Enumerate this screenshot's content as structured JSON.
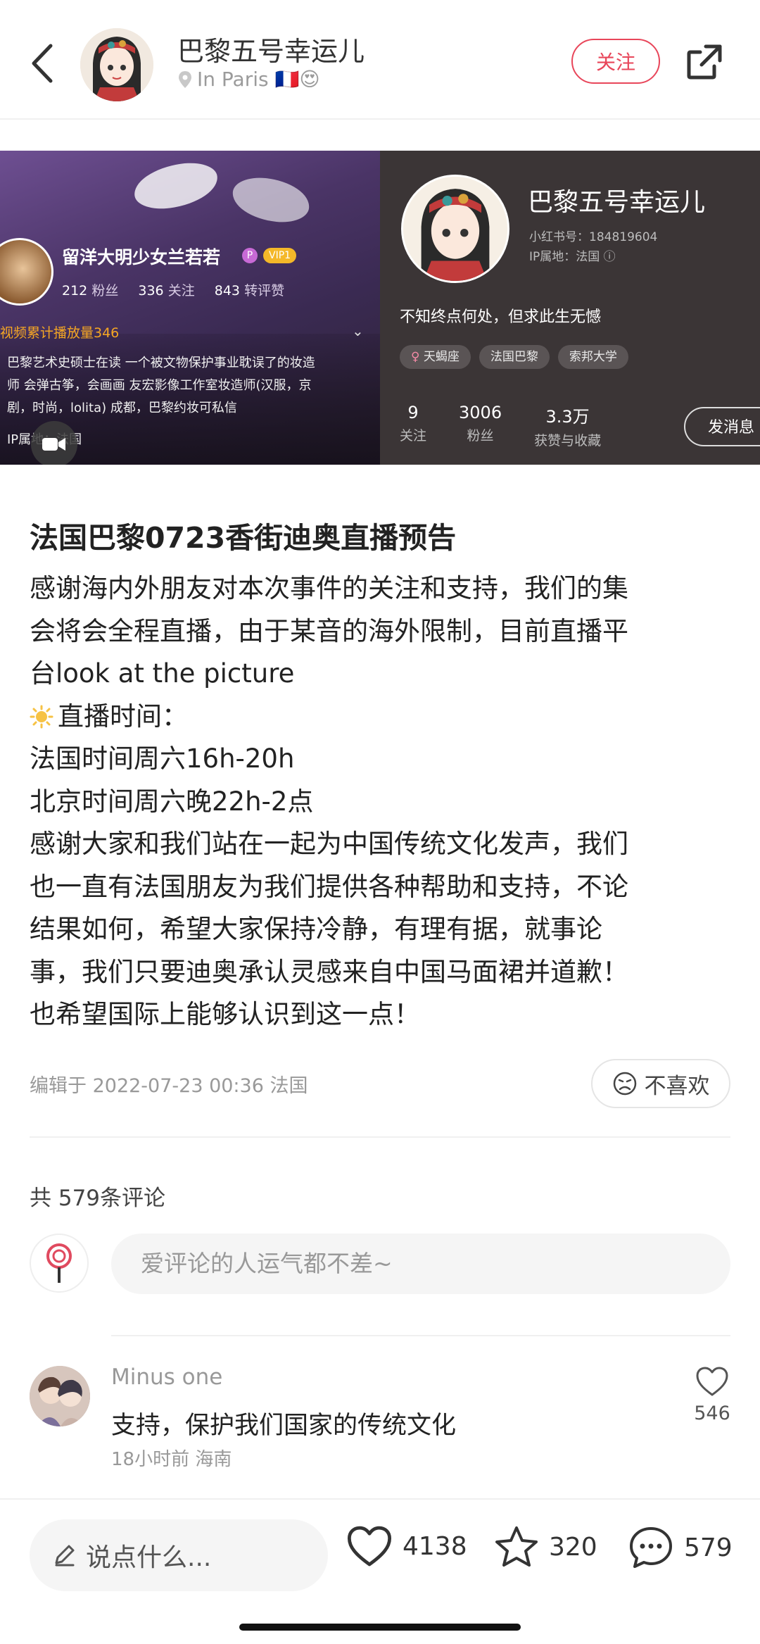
{
  "header": {
    "author_name": "巴黎五号幸运儿",
    "location": "In Paris 🇫🇷😍",
    "follow_label": "关注"
  },
  "banner_left": {
    "name": "留洋大明少女兰若若",
    "p_badge": "P",
    "vip_badge": "VIP1",
    "stats": [
      {
        "num": "212",
        "label": "粉丝"
      },
      {
        "num": "336",
        "label": "关注"
      },
      {
        "num": "843",
        "label": "转评赞"
      }
    ],
    "play_text": "视频累计播放量346",
    "bio_lines": [
      "巴黎艺术史硕士在读 一个被文物保护事业耽误了的妆造",
      "师 会弹古筝，会画画 友宏影像工作室妆造师(汉服，京",
      "剧，时尚，lolita) 成都，巴黎约妆可私信"
    ],
    "ip_text": "IP属地：法国"
  },
  "banner_right": {
    "name": "巴黎五号幸运儿",
    "id_text": "小红书号：184819604",
    "ip_text": "IP属地：法国",
    "bio": "不知终点何处，但求此生无憾",
    "tags": [
      "天蝎座",
      "法国巴黎",
      "索邦大学"
    ],
    "stats": [
      {
        "num": "9",
        "label": "关注"
      },
      {
        "num": "3006",
        "label": "粉丝"
      },
      {
        "num": "3.3万",
        "label": "获赞与收藏"
      }
    ],
    "message_label": "发消息"
  },
  "post": {
    "title": "法国巴黎0723香街迪奥直播预告",
    "lines": [
      "感谢海内外朋友对本次事件的关注和支持，我们的集",
      "会将会全程直播，由于某音的海外限制，目前直播平",
      "台look at the picture",
      "直播时间：",
      "法国时间周六16h-20h",
      "北京时间周六晚22h-2点",
      "感谢大家和我们站在一起为中国传统文化发声，我们",
      "也一直有法国朋友为我们提供各种帮助和支持，不论",
      "结果如何，希望大家保持冷静，有理有据，就事论",
      "事，我们只要迪奥承认灵感来自中国马面裙并道歉！",
      "也希望国际上能够认识到这一点！"
    ],
    "meta": "编辑于 2022-07-23 00:36 法国",
    "dislike_label": "不喜欢"
  },
  "comments": {
    "count_label": "共 579条评论",
    "input_placeholder": "爱评论的人运气都不差~",
    "items": [
      {
        "user": "Minus one",
        "text": "支持，保护我们国家的传统文化",
        "meta": "18小时前  海南",
        "likes": "546"
      }
    ]
  },
  "bottom_bar": {
    "say_label": "说点什么...",
    "likes": "4138",
    "collects": "320",
    "comments": "579"
  },
  "colors": {
    "accent": "#e8465a",
    "banner_right_bg": "#3b3536"
  }
}
